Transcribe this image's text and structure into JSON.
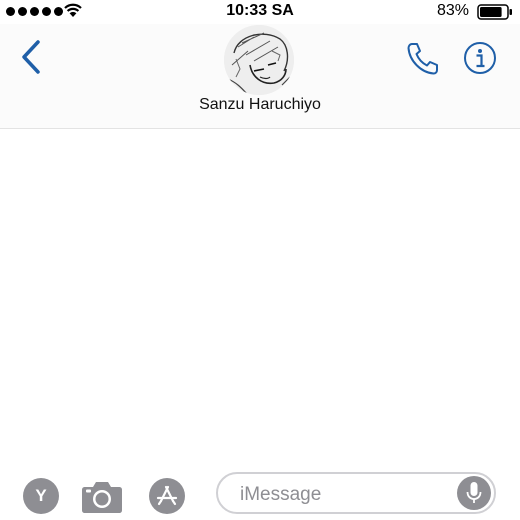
{
  "status_bar": {
    "time": "10:33 SA",
    "battery_percent": "83%",
    "battery_level": 0.83,
    "signal_bars": 5
  },
  "header": {
    "contact_name": "Sanzu Haruchiyo",
    "back_icon": "chevron-left-icon",
    "phone_icon": "phone-icon",
    "info_icon": "info-icon",
    "accent_color": "#1f5fa8"
  },
  "composer": {
    "placeholder": "iMessage",
    "y_button_label": "Y",
    "camera_icon": "camera-icon",
    "appstore_icon": "app-store-icon",
    "mic_icon": "microphone-icon",
    "button_color": "#8e8e93"
  }
}
